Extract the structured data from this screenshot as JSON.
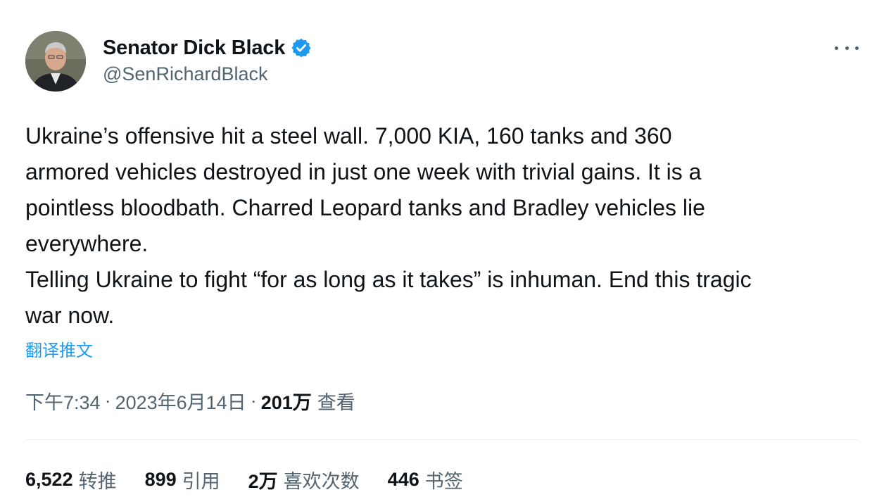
{
  "author": {
    "display_name": "Senator Dick Black",
    "handle": "@SenRichardBlack",
    "verified": true,
    "verified_color": "#1d9bf0"
  },
  "menu": {
    "more_icon": "more-horizontal-icon"
  },
  "tweet": {
    "lines": [
      "Ukraine’s offensive hit a steel wall. 7,000 KIA, 160 tanks and 360",
      "armored vehicles destroyed in just one week with trivial gains. It is a",
      "pointless bloodbath. Charred Leopard tanks and Bradley vehicles lie",
      "everywhere.",
      "Telling Ukraine to fight “for as long as it takes” is inhuman. End this tragic",
      "war now."
    ],
    "translate_label": "翻译推文"
  },
  "meta": {
    "time": "下午7:34",
    "separator": "·",
    "date": "2023年6月14日",
    "views_count": "201万",
    "views_label": "查看"
  },
  "stats": [
    {
      "count": "6,522",
      "label": "转推"
    },
    {
      "count": "899",
      "label": "引用"
    },
    {
      "count": "2万",
      "label": "喜欢次数"
    },
    {
      "count": "446",
      "label": "书签"
    }
  ],
  "colors": {
    "text_primary": "#0f1419",
    "text_secondary": "#536471",
    "link": "#1d9bf0",
    "divider": "#eff3f4"
  }
}
